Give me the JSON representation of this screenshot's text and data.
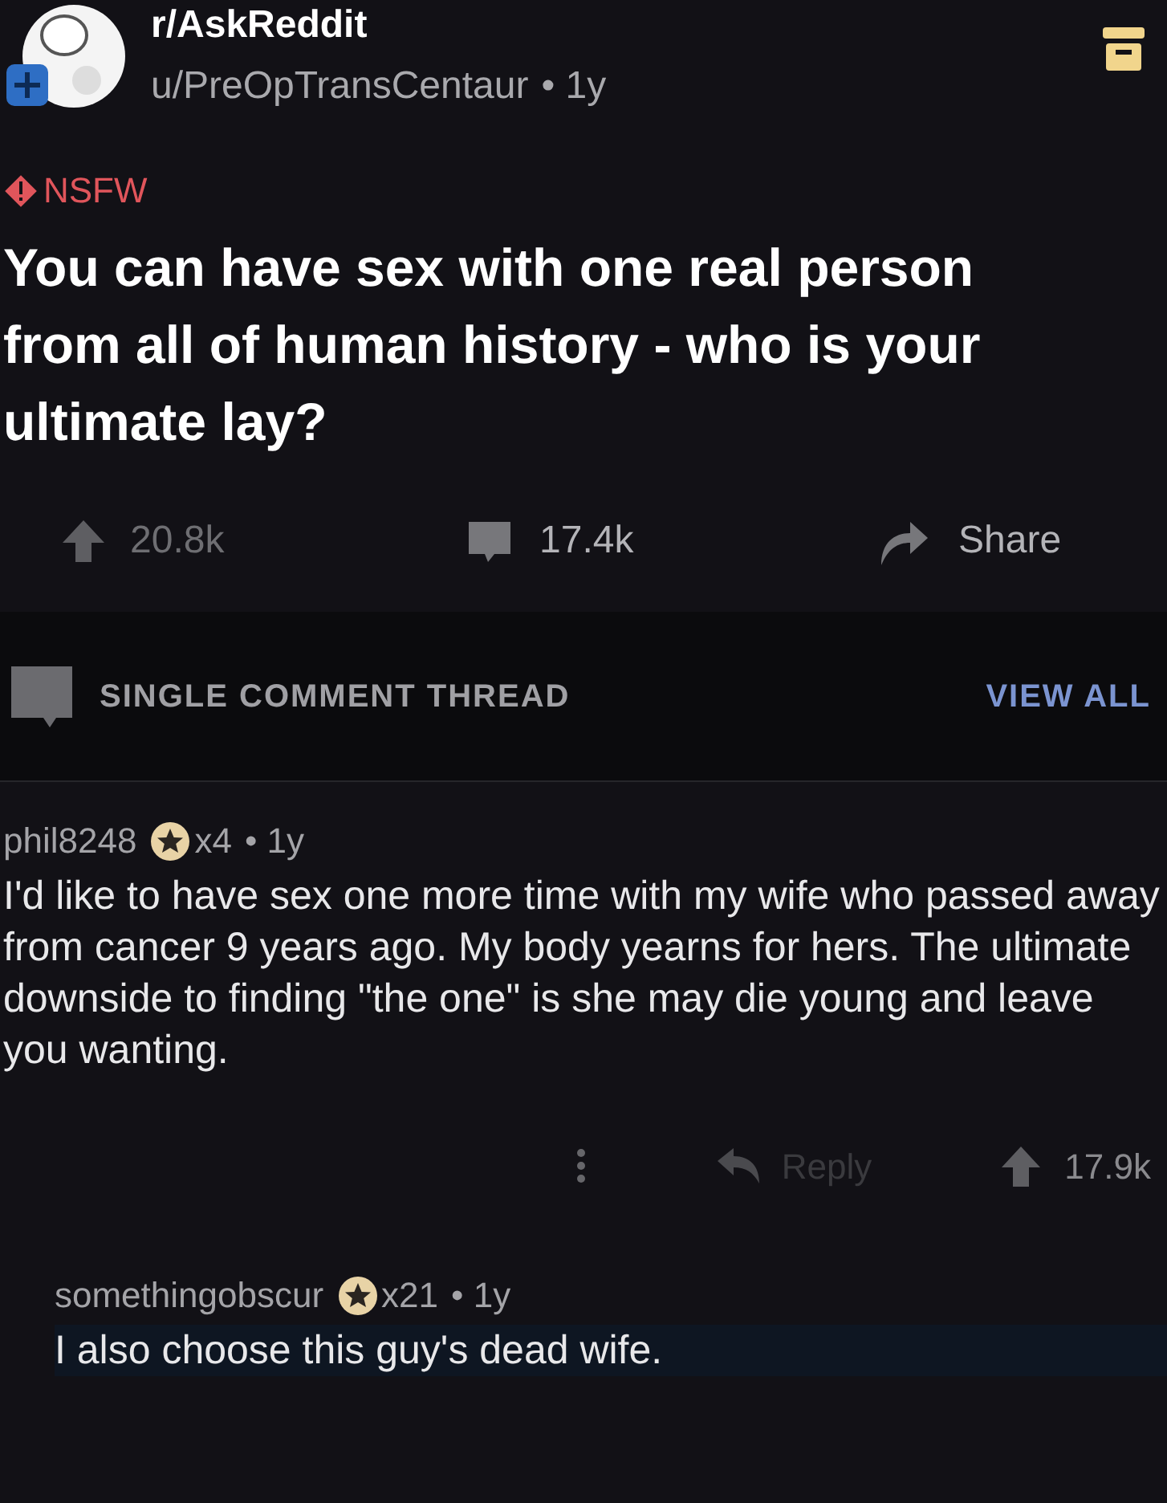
{
  "post": {
    "subreddit": "r/AskReddit",
    "author": "u/PreOpTransCentaur",
    "age": "• 1y",
    "nsfw_label": "NSFW",
    "title": "You can have sex with one real person from all of human history - who is your ultimate lay?",
    "upvotes": "20.8k",
    "comments": "17.4k",
    "share": "Share"
  },
  "thread_bar": {
    "label": "SINGLE COMMENT THREAD",
    "view_all": "VIEW ALL"
  },
  "comments": [
    {
      "author": "phil8248",
      "awards": "x4",
      "age": "• 1y",
      "body": "I'd like to have sex one more time with my wife who passed away from cancer 9 years ago. My body yearns for hers. The ultimate downside to finding \"the one\" is she may die young and leave you wanting.",
      "reply": "Reply",
      "score": "17.9k",
      "highlighted": false
    },
    {
      "author": "somethingobscur",
      "awards": "x21",
      "age": "• 1y",
      "body": "I also choose this guy's dead wife.",
      "highlighted": true
    }
  ]
}
